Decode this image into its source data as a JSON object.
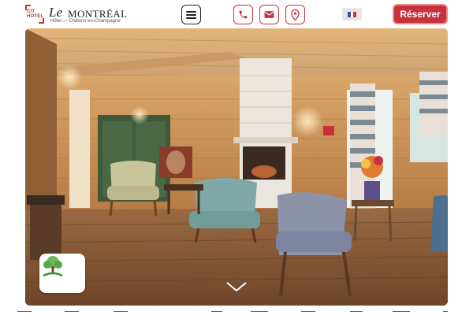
{
  "header": {
    "logo": {
      "mark_text": "CIT HOTEL",
      "script_text": "Le",
      "name": "MONTRÉAL",
      "subtitle": "Hôtel — Châlons-en-Champagne"
    },
    "menu_icon": "hamburger-menu-icon",
    "contact_icons": [
      "phone-icon",
      "mail-icon",
      "location-pin-icon"
    ],
    "language": {
      "flag": "fr-flag-icon",
      "colors": [
        "#2c4fa3",
        "#ffffff",
        "#d6323a"
      ]
    },
    "reserve_label": "Réserver"
  },
  "hero": {
    "image_subject": "hotel lounge with wooden walls, armchairs and fireplace",
    "badge_icon": "eco-tree-icon",
    "scroll_icon": "chevron-down-icon"
  },
  "colors": {
    "accent": "#c8323c",
    "dark": "#222222"
  }
}
